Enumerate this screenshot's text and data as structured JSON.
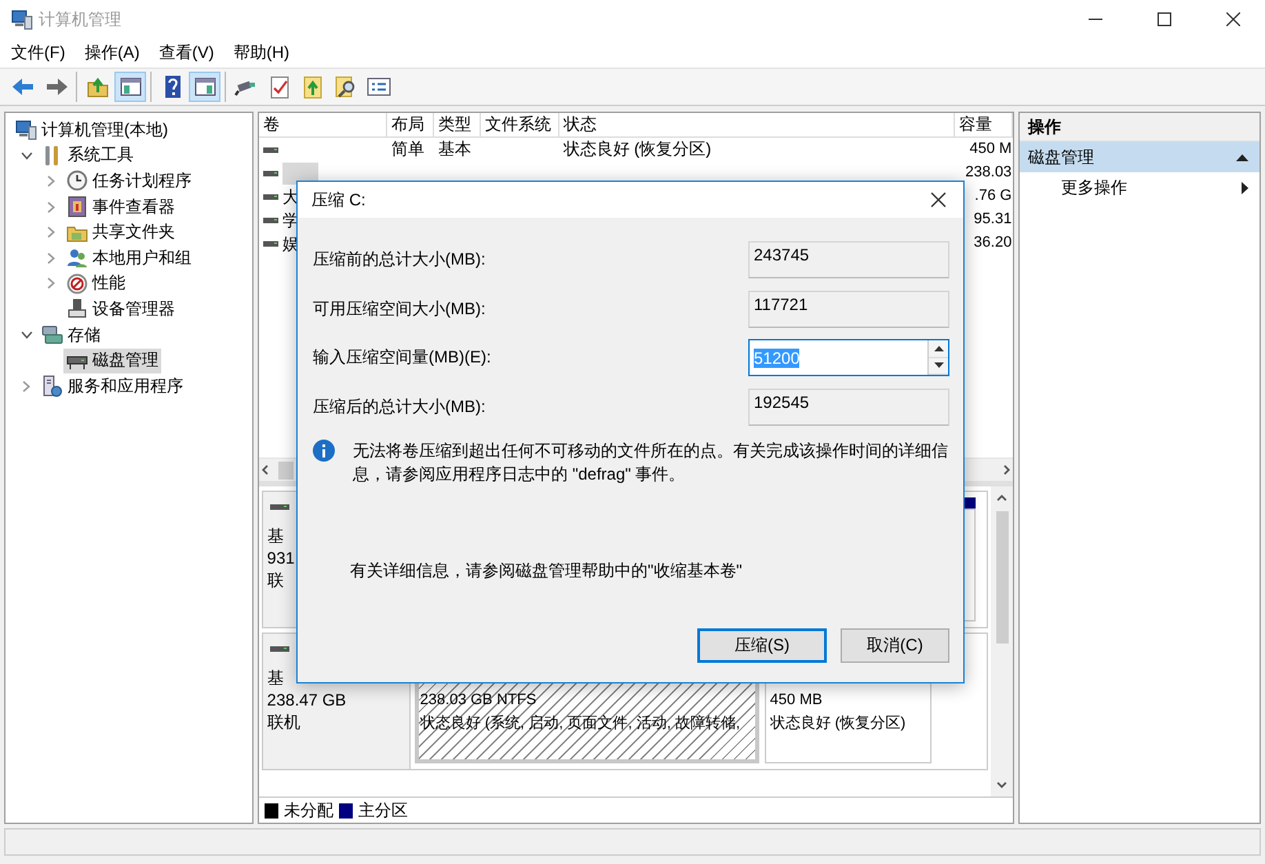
{
  "window": {
    "title": "计算机管理"
  },
  "menu": [
    "文件(F)",
    "操作(A)",
    "查看(V)",
    "帮助(H)"
  ],
  "toolbar": [
    [
      {
        "kind": "back",
        "pressed": false
      },
      {
        "kind": "forward",
        "pressed": false
      }
    ],
    [
      {
        "kind": "up",
        "pressed": false
      },
      {
        "kind": "tree",
        "pressed": true
      }
    ],
    [
      {
        "kind": "help",
        "pressed": false
      },
      {
        "kind": "pane",
        "pressed": true
      }
    ],
    [
      {
        "kind": "connect",
        "pressed": false
      },
      {
        "kind": "check",
        "pressed": false
      },
      {
        "kind": "export",
        "pressed": false
      },
      {
        "kind": "find",
        "pressed": false
      },
      {
        "kind": "list",
        "pressed": false
      }
    ]
  ],
  "tree": [
    {
      "label": "计算机管理(本地)",
      "kind": "computer",
      "selected": false,
      "children": [
        {
          "label": "系统工具",
          "kind": "tools",
          "expanded": true,
          "selected": false,
          "children": [
            {
              "label": "任务计划程序",
              "kind": "clock",
              "expanded": false,
              "selected": false
            },
            {
              "label": "事件查看器",
              "kind": "event",
              "expanded": false,
              "selected": false
            },
            {
              "label": "共享文件夹",
              "kind": "folder",
              "expanded": false,
              "selected": false
            },
            {
              "label": "本地用户和组",
              "kind": "users",
              "expanded": false,
              "selected": false
            },
            {
              "label": "性能",
              "kind": "perf",
              "expanded": false,
              "selected": false
            },
            {
              "label": "设备管理器",
              "kind": "device",
              "selected": false
            }
          ]
        },
        {
          "label": "存储",
          "kind": "storage",
          "expanded": true,
          "selected": false,
          "children": [
            {
              "label": "磁盘管理",
              "kind": "disk",
              "selected": true
            }
          ]
        },
        {
          "label": "服务和应用程序",
          "kind": "services",
          "expanded": false,
          "selected": false
        }
      ]
    }
  ],
  "volume_table": {
    "columns": [
      "卷",
      "布局",
      "类型",
      "文件系统",
      "状态",
      "容量"
    ],
    "rows": [
      {
        "selected": false,
        "cells": [
          "",
          "简单",
          "基本",
          "",
          "状态良好 (恢复分区)",
          "450 M"
        ]
      },
      {
        "selected": true,
        "cells": [
          "",
          "",
          "",
          "",
          "",
          "238.03"
        ]
      },
      {
        "selected": false,
        "cells": [
          "大",
          "",
          "",
          "",
          "",
          ".76 G"
        ]
      },
      {
        "selected": false,
        "cells": [
          "学",
          "",
          "",
          "",
          "",
          "95.31"
        ]
      },
      {
        "selected": false,
        "cells": [
          "娱",
          "",
          "",
          "",
          "",
          "36.20"
        ]
      }
    ]
  },
  "disks": [
    {
      "info": [
        "基",
        "931",
        "联"
      ],
      "partitions": [
        {
          "kind": "primary",
          "selected": false
        }
      ]
    },
    {
      "info": [
        "基",
        "238.47 GB",
        "联机"
      ],
      "partitions": [
        {
          "kind": "primary",
          "selected": true,
          "size": "238.03 GB NTFS",
          "status": "状态良好 (系统, 启动, 页面文件, 活动, 故障转储,"
        },
        {
          "kind": "primary",
          "selected": false,
          "size": "450 MB",
          "status": "状态良好 (恢复分区)"
        }
      ]
    }
  ],
  "legend": [
    {
      "label": "未分配",
      "color": "#000000"
    },
    {
      "label": "主分区",
      "color": "#000080"
    }
  ],
  "actions": {
    "title": "操作",
    "sections": [
      {
        "label": "磁盘管理",
        "expanded": true,
        "items": [
          "更多操作"
        ]
      }
    ]
  },
  "dialog": {
    "title": "压缩 C:",
    "fields": [
      {
        "kind": "readonly",
        "label": "压缩前的总计大小(MB):",
        "value": "243745",
        "highlighted": false
      },
      {
        "kind": "readonly",
        "label": "可用压缩空间大小(MB):",
        "value": "117721",
        "highlighted": false
      },
      {
        "kind": "spin",
        "label": "输入压缩空间量(MB)(E):",
        "value": "51200",
        "highlighted": true
      },
      {
        "kind": "readonly",
        "label": "压缩后的总计大小(MB):",
        "value": "192545",
        "highlighted": false
      }
    ],
    "info": "无法将卷压缩到超出任何不可移动的文件所在的点。有关完成该操作时间的详细信息，请参阅应用程序日志中的 \"defrag\" 事件。",
    "help": "有关详细信息，请参阅磁盘管理帮助中的\"收缩基本卷\"",
    "buttons": [
      {
        "label": "压缩(S)",
        "default": true
      },
      {
        "label": "取消(C)",
        "default": false
      }
    ]
  }
}
